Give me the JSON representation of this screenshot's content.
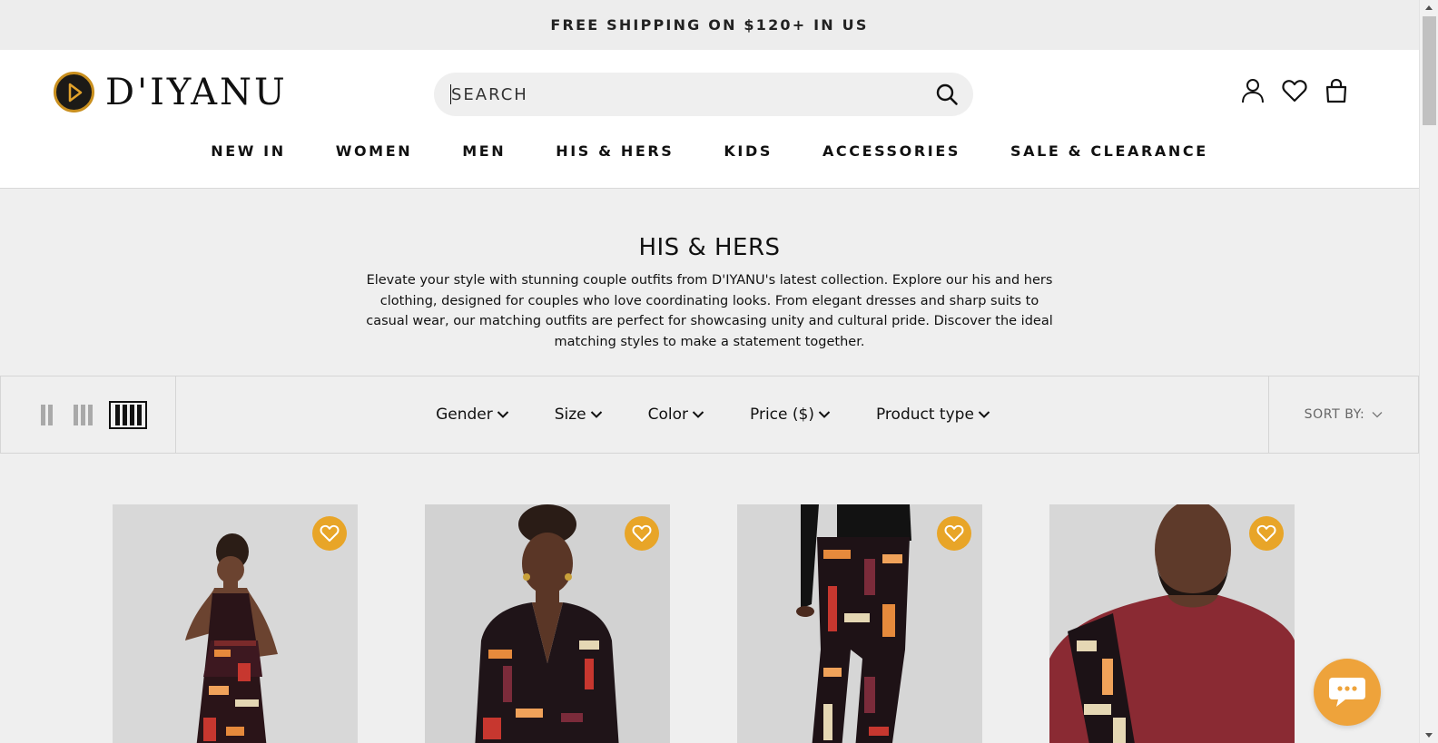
{
  "announcement": {
    "text": "FREE SHIPPING ON $120+ IN US"
  },
  "header": {
    "logo_text": "D'IYANU",
    "search": {
      "placeholder": "SEARCH"
    },
    "icons": [
      "account-icon",
      "wishlist-icon",
      "cart-icon"
    ]
  },
  "nav": {
    "items": [
      {
        "label": "NEW IN"
      },
      {
        "label": "WOMEN"
      },
      {
        "label": "MEN"
      },
      {
        "label": "HIS & HERS"
      },
      {
        "label": "KIDS"
      },
      {
        "label": "ACCESSORIES"
      },
      {
        "label": "SALE & CLEARANCE"
      }
    ]
  },
  "collection": {
    "title": "HIS & HERS",
    "description": "Elevate your style with stunning couple outfits from D'IYANU's latest collection. Explore our his and hers clothing, designed for couples who love coordinating looks. From elegant dresses and sharp suits to casual wear, our matching outfits are perfect for showcasing unity and cultural pride. Discover the ideal matching styles to make a statement together."
  },
  "filters": {
    "layout_options": [
      "2-column",
      "3-column",
      "4-column"
    ],
    "selected_layout": "4-column",
    "items": [
      {
        "label": "Gender"
      },
      {
        "label": "Size"
      },
      {
        "label": "Color"
      },
      {
        "label": "Price ($)"
      },
      {
        "label": "Product type"
      }
    ],
    "sort_label": "SORT BY:"
  },
  "colors": {
    "brand_gold": "#c98f1e",
    "wishlist_button": "#e8a528",
    "chat_button": "#eea33b"
  },
  "products": [
    {
      "image": "woman-in-patterned-halter-dress"
    },
    {
      "image": "woman-in-patterned-v-neck-dress"
    },
    {
      "image": "patterned-trousers"
    },
    {
      "image": "man-in-maroon-patterned-shirt"
    }
  ]
}
